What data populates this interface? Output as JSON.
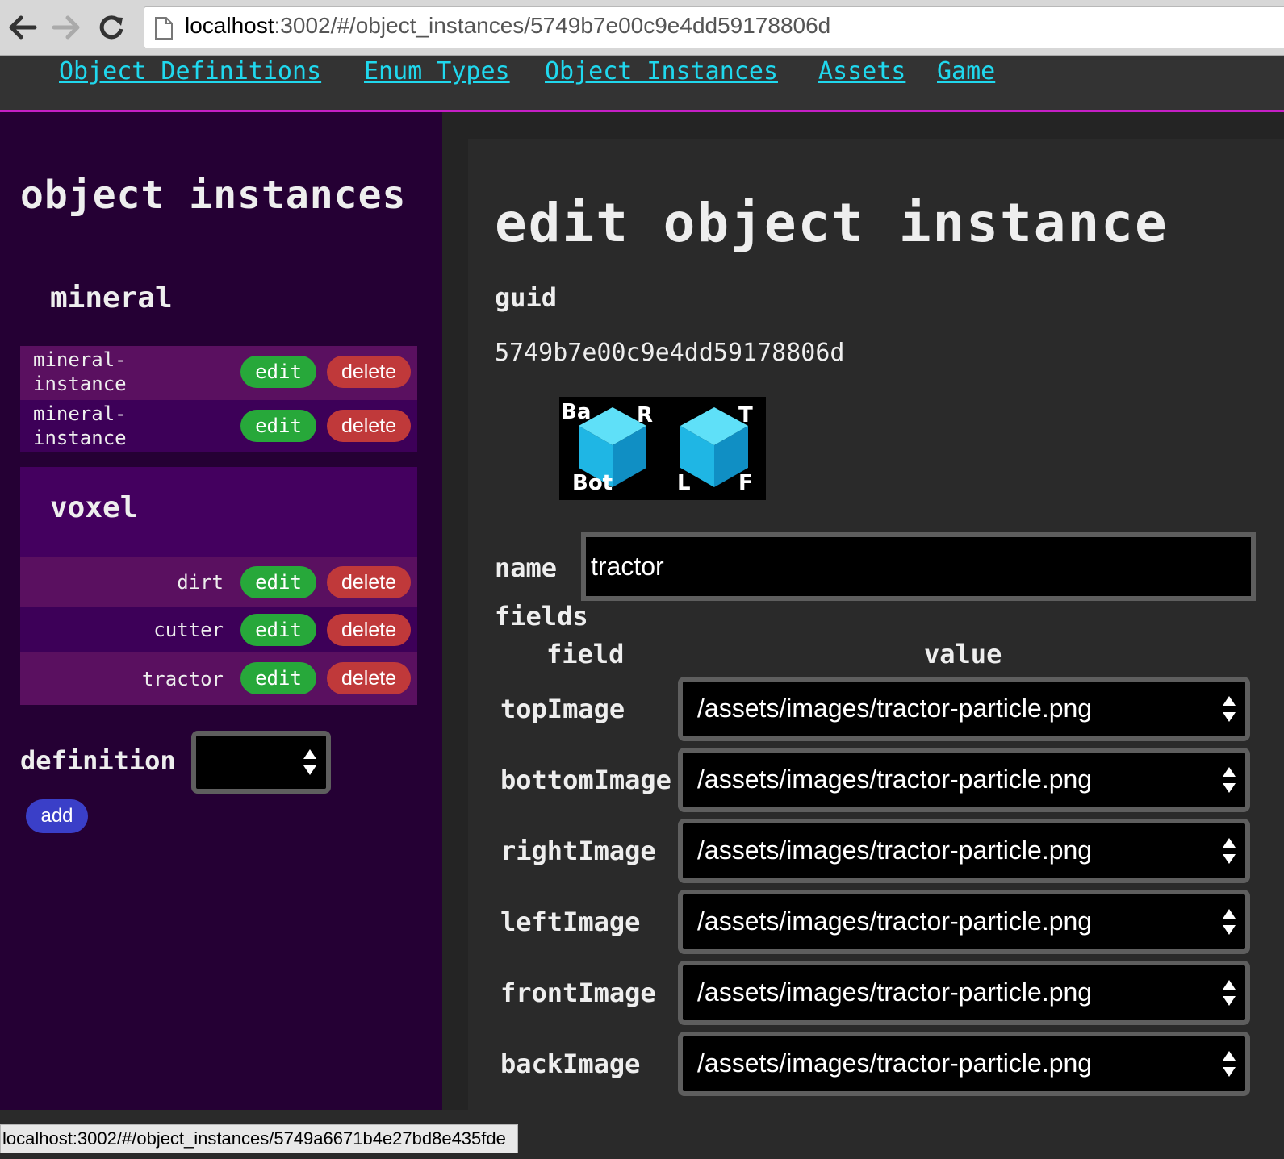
{
  "browser": {
    "url_host": "localhost",
    "url_rest": ":3002/#/object_instances/5749b7e00c9e4dd59178806d",
    "status_url": "localhost:3002/#/object_instances/5749a6671b4e27bd8e435fde"
  },
  "nav": {
    "links": [
      "Object Definitions",
      "Enum Types",
      "Object Instances",
      "Assets",
      "Game"
    ]
  },
  "left": {
    "title": "object instances",
    "groups": [
      {
        "name": "mineral",
        "items": [
          {
            "label": "mineral-\ninstance",
            "edit": "edit",
            "delete": "delete"
          },
          {
            "label": "mineral-\ninstance",
            "edit": "edit",
            "delete": "delete"
          }
        ]
      },
      {
        "name": "voxel",
        "items": [
          {
            "label": "dirt",
            "edit": "edit",
            "delete": "delete"
          },
          {
            "label": "cutter",
            "edit": "edit",
            "delete": "delete"
          },
          {
            "label": "tractor",
            "edit": "edit",
            "delete": "delete"
          }
        ]
      }
    ],
    "definition_label": "definition",
    "definition_value": "",
    "add_label": "add"
  },
  "right": {
    "title": "edit object instance",
    "guid_label": "guid",
    "guid_value": "5749b7e00c9e4dd59178806d",
    "preview_tags": {
      "back": "Ba",
      "right": "R",
      "bottom": "Bot",
      "top": "T",
      "left": "L",
      "front": "F"
    },
    "name_label": "name",
    "name_value": "tractor",
    "fields_label": "fields",
    "col_field": "field",
    "col_value": "value",
    "fields": [
      {
        "name": "topImage",
        "value": "/assets/images/tractor-particle.png"
      },
      {
        "name": "bottomImage",
        "value": "/assets/images/tractor-particle.png"
      },
      {
        "name": "rightImage",
        "value": "/assets/images/tractor-particle.png"
      },
      {
        "name": "leftImage",
        "value": "/assets/images/tractor-particle.png"
      },
      {
        "name": "frontImage",
        "value": "/assets/images/tractor-particle.png"
      },
      {
        "name": "backImage",
        "value": "/assets/images/tractor-particle.png"
      }
    ]
  },
  "colors": {
    "nav_link": "#20d8ee",
    "left_bg": "#250034",
    "edit_button": "#27a83a",
    "delete_button": "#c0393a",
    "add_button": "#3a3fc8",
    "cube": "#29c6ee"
  }
}
